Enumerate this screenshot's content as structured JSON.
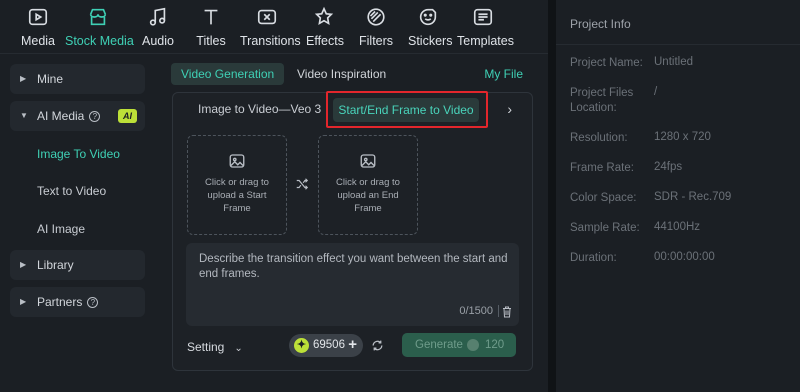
{
  "toolbar": {
    "items": [
      {
        "label": "Media",
        "icon": "media-icon"
      },
      {
        "label": "Stock Media",
        "icon": "stock-media-icon"
      },
      {
        "label": "Audio",
        "icon": "audio-icon"
      },
      {
        "label": "Titles",
        "icon": "titles-icon"
      },
      {
        "label": "Transitions",
        "icon": "transitions-icon"
      },
      {
        "label": "Effects",
        "icon": "effects-icon"
      },
      {
        "label": "Filters",
        "icon": "filters-icon"
      },
      {
        "label": "Stickers",
        "icon": "stickers-icon"
      },
      {
        "label": "Templates",
        "icon": "templates-icon"
      }
    ],
    "active": "Stock Media"
  },
  "sidebar": {
    "mine": "Mine",
    "ai_media": "AI Media",
    "ai_badge": "AI",
    "image_to_video": "Image To Video",
    "text_to_video": "Text to Video",
    "ai_image": "AI Image",
    "library": "Library",
    "partners": "Partners"
  },
  "main": {
    "tabs": [
      "Video Generation",
      "Video Inspiration"
    ],
    "my_file": "My File",
    "sub_tabs": [
      "Image to Video—Veo 3",
      "Start/End Frame to Video"
    ],
    "upload_start": "Click or drag to upload a Start Frame",
    "upload_end": "Click or drag to upload an End Frame",
    "prompt_placeholder": "Describe the transition effect you want between the start and end frames.",
    "char_count": "0/1500",
    "setting_label": "Setting",
    "credits": "69506",
    "generate_label": "Generate",
    "generate_cost": "120"
  },
  "project_info": {
    "title": "Project Info",
    "rows": [
      {
        "label": "Project Name:",
        "value": "Untitled"
      },
      {
        "label": "Project Files Location:",
        "value": "/"
      },
      {
        "label": "Resolution:",
        "value": "1280 x 720"
      },
      {
        "label": "Frame Rate:",
        "value": "24fps"
      },
      {
        "label": "Color Space:",
        "value": "SDR - Rec.709"
      },
      {
        "label": "Sample Rate:",
        "value": "44100Hz"
      },
      {
        "label": "Duration:",
        "value": "00:00:00:00"
      }
    ]
  },
  "colors": {
    "accent": "#3fd0b5",
    "ai_badge": "#bce038",
    "highlight": "#e2262c",
    "background": "#1b1f24"
  }
}
